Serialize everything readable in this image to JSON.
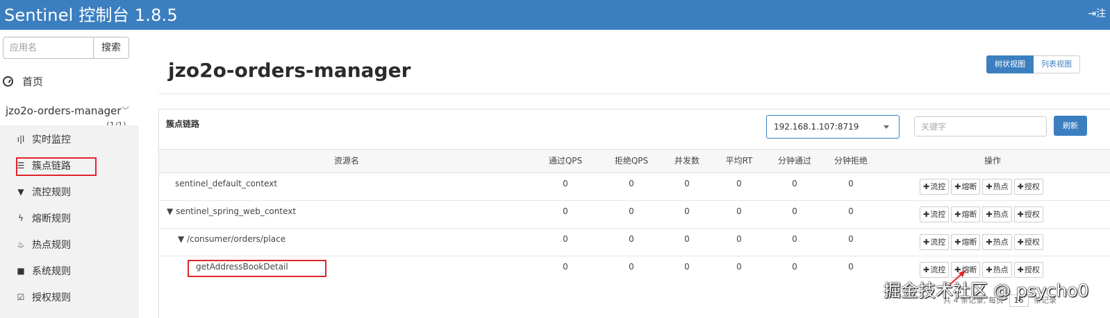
{
  "header": {
    "brand": "Sentinel 控制台 1.8.5",
    "logout_label": "⇥注"
  },
  "sidebar": {
    "search_placeholder": "应用名",
    "search_button": "搜索",
    "home_label": "首页",
    "app_name": "jzo2o-orders-manager",
    "app_count": "(1/1)",
    "items": [
      {
        "label": "实时监控",
        "icon": "bar-chart-icon"
      },
      {
        "label": "簇点链路",
        "icon": "list-icon"
      },
      {
        "label": "流控规则",
        "icon": "filter-icon"
      },
      {
        "label": "熔断规则",
        "icon": "flash-icon"
      },
      {
        "label": "热点规则",
        "icon": "fire-icon"
      },
      {
        "label": "系统规则",
        "icon": "lock-icon"
      },
      {
        "label": "授权规则",
        "icon": "check-icon"
      }
    ]
  },
  "main": {
    "title": "jzo2o-orders-manager",
    "view_tree": "树状视图",
    "view_list": "列表视图",
    "panel_title": "簇点链路",
    "machine": "192.168.1.107:8719",
    "keyword_placeholder": "关键字",
    "refresh_button": "刷新",
    "columns": [
      "资源名",
      "通过QPS",
      "拒绝QPS",
      "并发数",
      "平均RT",
      "分钟通过",
      "分钟拒绝",
      "操作"
    ],
    "rows": [
      {
        "name": "sentinel_default_context",
        "prefix": "",
        "values": [
          "0",
          "0",
          "0",
          "0",
          "0",
          "0"
        ]
      },
      {
        "name": "sentinel_spring_web_context",
        "prefix": "▼",
        "values": [
          "0",
          "0",
          "0",
          "0",
          "0",
          "0"
        ]
      },
      {
        "name": "/consumer/orders/place",
        "prefix": "▼",
        "values": [
          "0",
          "0",
          "0",
          "0",
          "0",
          "0"
        ]
      },
      {
        "name": "getAddressBookDetail",
        "prefix": "",
        "values": [
          "0",
          "0",
          "0",
          "0",
          "0",
          "0"
        ]
      }
    ],
    "op_labels": [
      "流控",
      "熔断",
      "热点",
      "授权"
    ],
    "pager_prefix": "共 4 条记录, 每页",
    "pager_size": "16",
    "pager_suffix": "条记录"
  },
  "watermark": "掘金技术社区 @ psycho0",
  "colors": {
    "primary": "#3c7fc0",
    "highlight": "#e0242b"
  }
}
